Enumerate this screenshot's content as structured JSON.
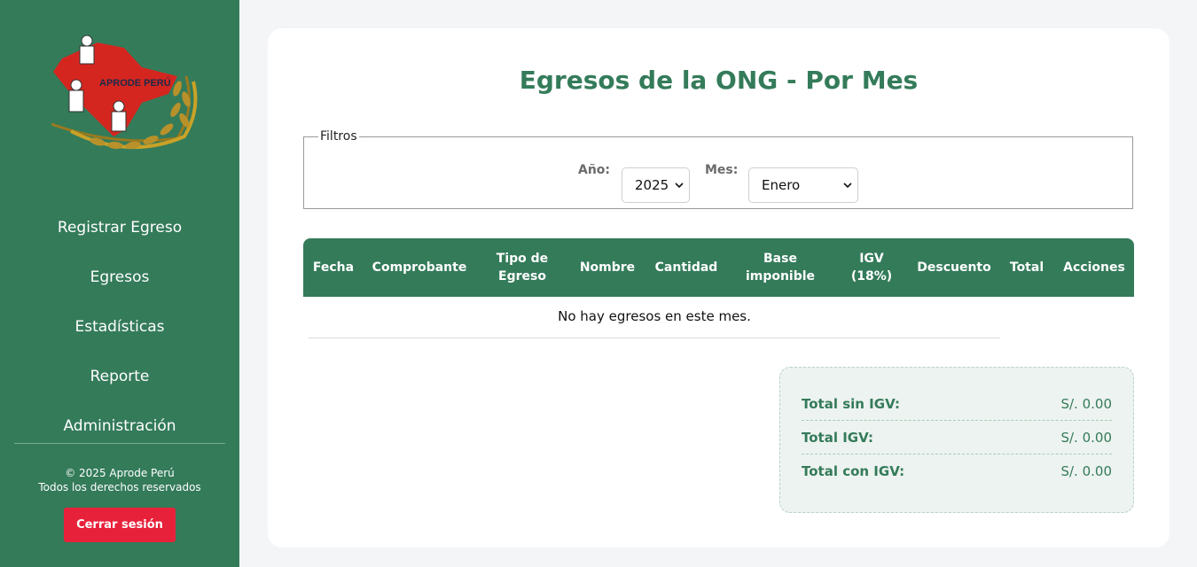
{
  "sidebar": {
    "logo_text": "APRODE PERÚ",
    "nav": [
      {
        "label": "Registrar Egreso"
      },
      {
        "label": "Egresos"
      },
      {
        "label": "Estadísticas"
      },
      {
        "label": "Reporte"
      },
      {
        "label": "Administración"
      }
    ],
    "copyright_line1": "© 2025 Aprode Perú",
    "copyright_line2": "Todos los derechos reservados",
    "logout_label": "Cerrar sesión"
  },
  "main": {
    "title": "Egresos de la ONG - Por Mes",
    "filters": {
      "legend": "Filtros",
      "year_label": "Año:",
      "year_value": "2025",
      "month_label": "Mes:",
      "month_value": "Enero"
    },
    "table": {
      "headers": [
        "Fecha",
        "Comprobante",
        "Tipo de Egreso",
        "Nombre",
        "Cantidad",
        "Base imponible",
        "IGV (18%)",
        "Descuento",
        "Total",
        "Acciones"
      ],
      "empty_message": "No hay egresos en este mes."
    },
    "totals": [
      {
        "label": "Total sin IGV:",
        "value": "S/. 0.00"
      },
      {
        "label": "Total IGV:",
        "value": "S/. 0.00"
      },
      {
        "label": "Total con IGV:",
        "value": "S/. 0.00"
      }
    ]
  },
  "colors": {
    "brand_green": "#347b5a",
    "logout_red": "#e8213a",
    "background": "#f4f5f7"
  }
}
